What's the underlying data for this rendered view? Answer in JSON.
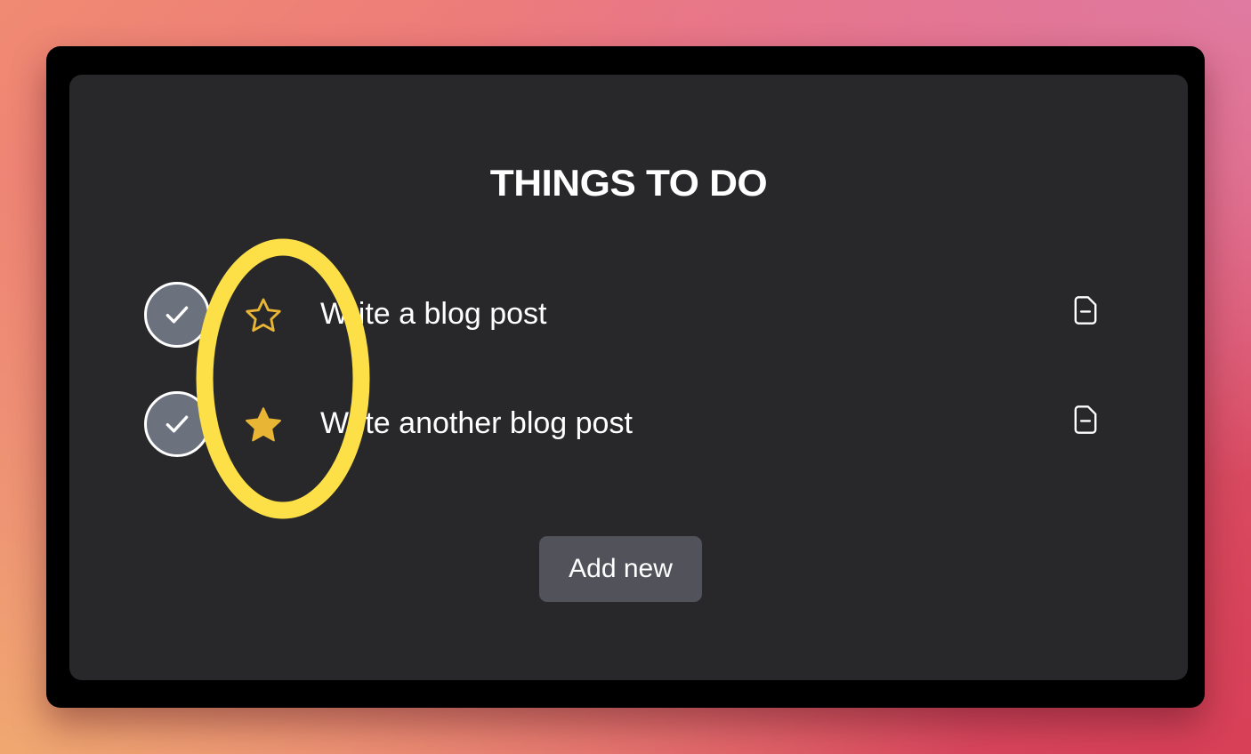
{
  "app": {
    "title": "THINGS TO DO"
  },
  "todos": [
    {
      "text": "Write a blog post",
      "completed_icon": "checkmark-icon",
      "starred": false,
      "star_icon": "star-outline-icon",
      "action_icon": "document-minus-icon"
    },
    {
      "text": "Write another blog post",
      "completed_icon": "checkmark-icon",
      "starred": true,
      "star_icon": "star-filled-icon",
      "action_icon": "document-minus-icon"
    }
  ],
  "actions": {
    "add_label": "Add new"
  },
  "annotation": {
    "shape": "ellipse",
    "color": "#fde047"
  },
  "colors": {
    "panel_background": "#28282b",
    "frame_background": "#000000",
    "check_fill": "#6c717e",
    "star": "#e8b535",
    "button_background": "#52525b",
    "text": "#ffffff"
  }
}
